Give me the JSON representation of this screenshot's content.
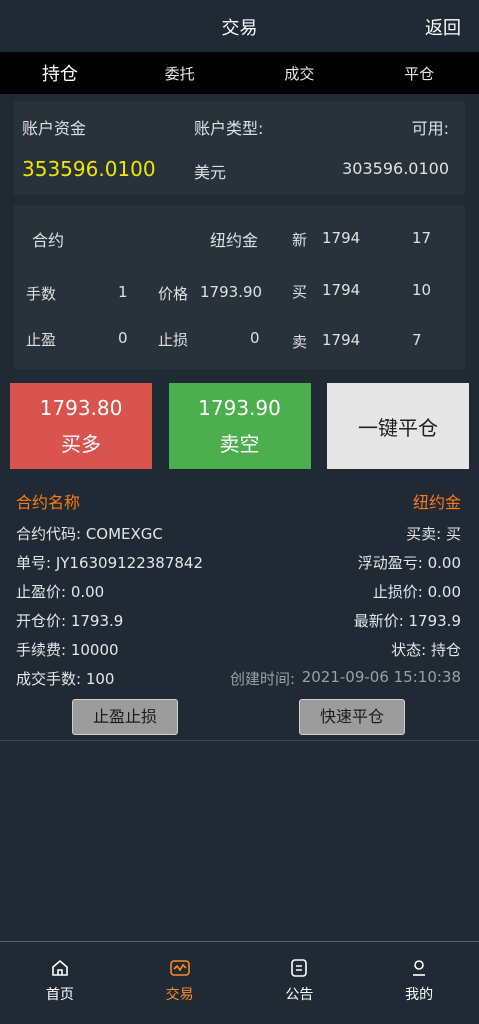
{
  "header": {
    "title": "交易",
    "back": "返回"
  },
  "tabs": [
    {
      "label": "持仓",
      "active": true
    },
    {
      "label": "委托"
    },
    {
      "label": "成交"
    },
    {
      "label": "平仓"
    }
  ],
  "account": {
    "funds_label": "账户资金",
    "type_label": "账户类型:",
    "available_label": "可用:",
    "funds_value": "353596.0100",
    "type_value": "美元",
    "available_value": "303596.0100"
  },
  "contract": {
    "label": "合约",
    "name": "纽约金",
    "lots_label": "手数",
    "lots": "1",
    "price_label": "价格",
    "price": "1793.90",
    "tp_label": "止盈",
    "tp": "0",
    "sl_label": "止损",
    "sl": "0",
    "quotes": [
      {
        "side": "新",
        "price": "1794",
        "qty": "17"
      },
      {
        "side": "买",
        "price": "1794",
        "qty": "10"
      },
      {
        "side": "卖",
        "price": "1794",
        "qty": "7"
      }
    ]
  },
  "actions": {
    "buy_price": "1793.80",
    "buy_label": "买多",
    "sell_price": "1793.90",
    "sell_label": "卖空",
    "close_label": "一键平仓"
  },
  "position": {
    "name_label": "合约名称",
    "name_value": "纽约金",
    "code": "合约代码:   COMEXGC",
    "direction": "买卖:   买",
    "order_no": "单号:   JY16309122387842",
    "float_pl": "浮动盈亏:   0.00",
    "tp": "止盈价:   0.00",
    "sl": "止损价:   0.00",
    "open_price": "开仓价:   1793.9",
    "last_price": "最新价:   1793.9",
    "fee": "手续费:   10000",
    "status": "状态:   持仓",
    "filled": "成交手数:   100",
    "created_label": "创建时间:",
    "created_value": "2021-09-06 15:10:38",
    "tpsl_button": "止盈止损",
    "quick_close_button": "快速平仓"
  },
  "bottom_nav": [
    {
      "label": "首页",
      "icon": "home-icon"
    },
    {
      "label": "交易",
      "icon": "trade-icon",
      "active": true
    },
    {
      "label": "公告",
      "icon": "notice-icon"
    },
    {
      "label": "我的",
      "icon": "user-icon"
    }
  ],
  "colors": {
    "accent": "#ff7a14",
    "buy": "#d9534f",
    "sell": "#4cae4c",
    "highlight": "#f3e500"
  }
}
